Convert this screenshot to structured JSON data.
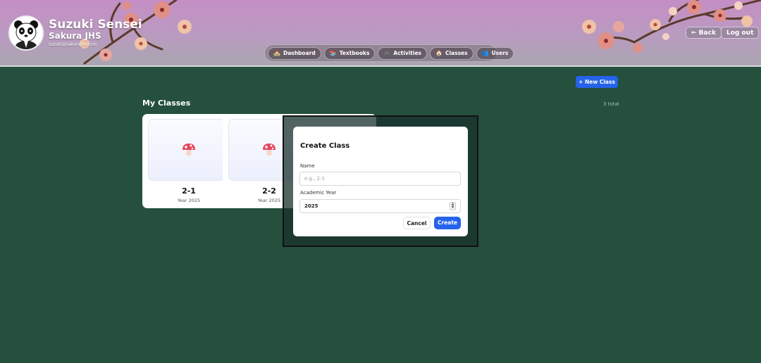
{
  "header": {
    "teacher_name": "Suzuki Sensei",
    "school": "Sakura JHS",
    "email": "suzuki@sakurajhs.com",
    "back_label": "← Back",
    "logout_label": "Log out"
  },
  "nav": [
    {
      "label": "Dashboard",
      "icon": "🏫",
      "icon_name": "school-icon"
    },
    {
      "label": "Textbooks",
      "icon": "📚",
      "icon_name": "books-icon"
    },
    {
      "label": "Activities",
      "icon": "🎮",
      "icon_name": "gamepad-icon"
    },
    {
      "label": "Classes",
      "icon": "🏠",
      "icon_name": "house-icon"
    },
    {
      "label": "Users",
      "icon": "👥",
      "icon_name": "users-icon"
    }
  ],
  "main": {
    "new_class_label": "+ New Class",
    "section_title": "My Classes",
    "total": "3 total",
    "classes": [
      {
        "name": "2-1",
        "year": "Year 2025",
        "icon": "mushroom-icon"
      },
      {
        "name": "2-2",
        "year": "Year 2025",
        "icon": "mushroom-icon"
      }
    ]
  },
  "dialog": {
    "title": "Create Class",
    "name_label": "Name",
    "name_placeholder": "e.g., 2-1",
    "year_label": "Academic Year",
    "year_value": "2025",
    "cancel_label": "Cancel",
    "create_label": "Create"
  },
  "colors": {
    "accent": "#2563eb",
    "background": "#24503d",
    "header_top": "#c58ec4"
  }
}
